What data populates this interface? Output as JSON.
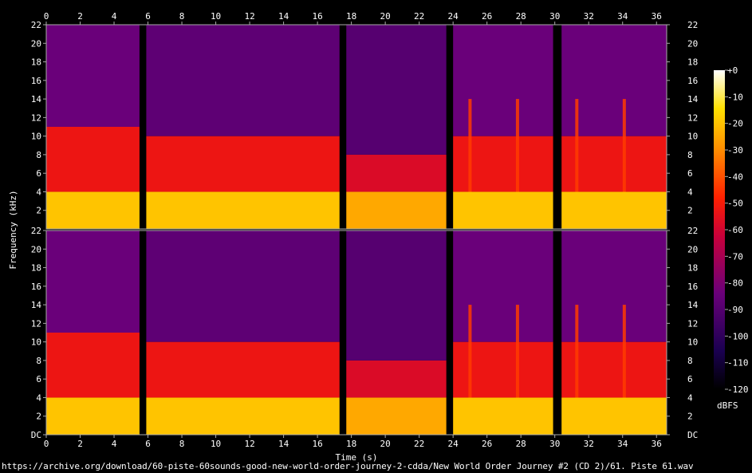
{
  "chart_data": {
    "type": "heatmap",
    "title": "",
    "xlabel": "Time (s)",
    "ylabel": "Frequency (kHz)",
    "xlim": [
      0,
      36.6
    ],
    "ylim": [
      0,
      22
    ],
    "x_ticks": [
      "0",
      "2",
      "4",
      "6",
      "8",
      "10",
      "12",
      "14",
      "16",
      "18",
      "20",
      "22",
      "24",
      "26",
      "28",
      "30",
      "32",
      "34",
      "36"
    ],
    "y_ticks": [
      "DC",
      "2",
      "4",
      "6",
      "8",
      "10",
      "12",
      "14",
      "16",
      "18",
      "20",
      "22"
    ],
    "channels": 2,
    "colorbar": {
      "label": "dBFS",
      "range": [
        -120,
        0
      ],
      "ticks": [
        "+0",
        "-10",
        "-20",
        "-30",
        "-40",
        "-50",
        "-60",
        "-70",
        "-80",
        "-90",
        "-100",
        "-110",
        "-120"
      ]
    },
    "silent_gaps_s": [
      [
        5.5,
        5.9
      ],
      [
        17.3,
        17.7
      ],
      [
        23.6,
        24.0
      ],
      [
        29.9,
        30.4
      ]
    ],
    "segments": [
      {
        "start": 0,
        "end": 5.5,
        "bands": [
          [
            0,
            4,
            -20
          ],
          [
            4,
            11,
            -55
          ],
          [
            11,
            22,
            -85
          ]
        ]
      },
      {
        "start": 5.9,
        "end": 17.3,
        "bands": [
          [
            0,
            4,
            -20
          ],
          [
            4,
            10,
            -55
          ],
          [
            10,
            22,
            -88
          ]
        ]
      },
      {
        "start": 17.7,
        "end": 23.6,
        "bands": [
          [
            0,
            4,
            -25
          ],
          [
            4,
            8,
            -60
          ],
          [
            8,
            22,
            -90
          ]
        ]
      },
      {
        "start": 24.0,
        "end": 29.9,
        "bands": [
          [
            0,
            4,
            -20
          ],
          [
            4,
            10,
            -55
          ],
          [
            10,
            22,
            -85
          ]
        ]
      },
      {
        "start": 30.4,
        "end": 36.6,
        "bands": [
          [
            0,
            4,
            -20
          ],
          [
            4,
            10,
            -55
          ],
          [
            10,
            22,
            -85
          ]
        ]
      }
    ],
    "transients_s": [
      25.0,
      27.8,
      31.3,
      34.1
    ],
    "footer_path": "https://archive.org/download/60-piste-60sounds-good-new-world-order-journey-2-cdda/New World Order Journey #2 (CD 2)/61. Piste 61.wav"
  }
}
